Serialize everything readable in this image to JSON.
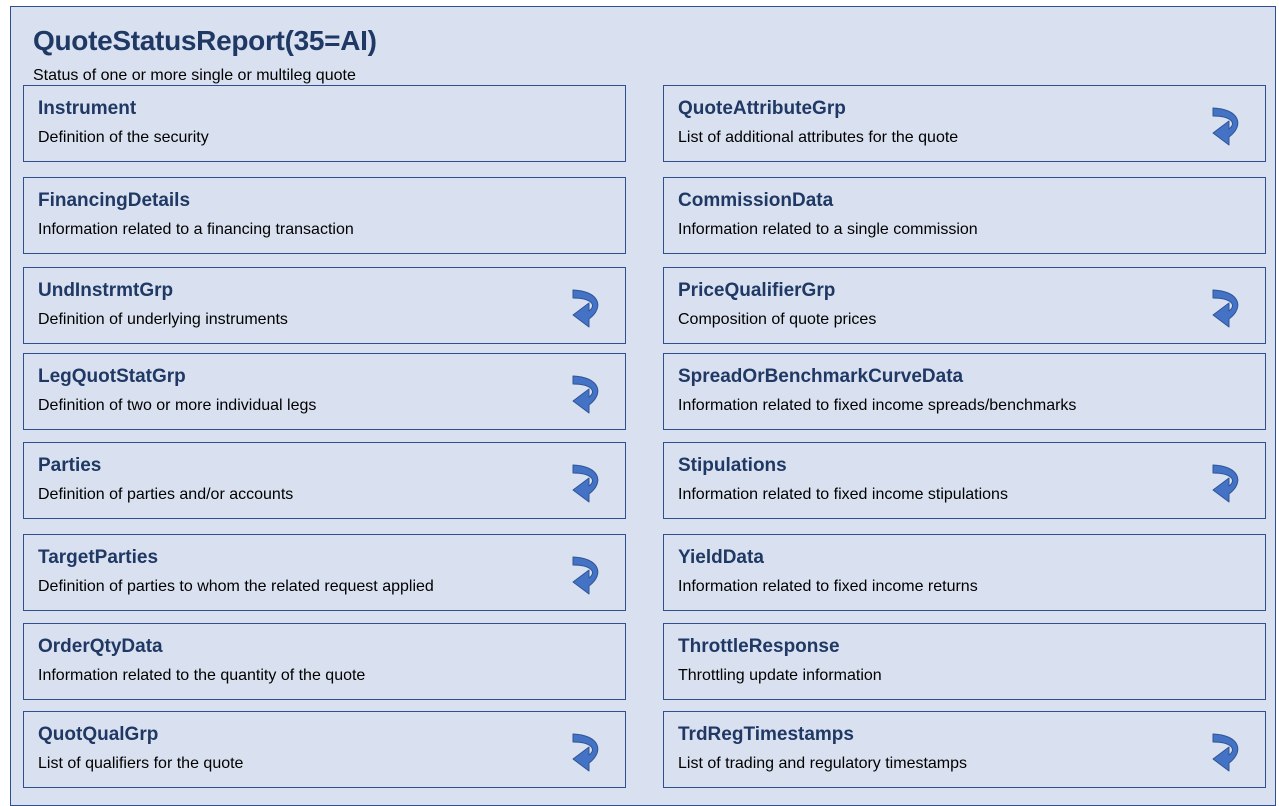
{
  "title": "QuoteStatusReport(35=AI)",
  "subtitle": "Status of one or more single or multileg quote",
  "icon": "repeating-group-curved-arrow-icon",
  "colors": {
    "accent": "#1f3864",
    "background": "#d9e1f0",
    "border": "#2f4f8f",
    "arrow": "#4472c4"
  },
  "left_column": [
    {
      "name": "Instrument",
      "desc": "Definition of the security",
      "repeating": false
    },
    {
      "name": "FinancingDetails",
      "desc": "Information related to a financing transaction",
      "repeating": false
    },
    {
      "name": "UndInstrmtGrp",
      "desc": "Definition of underlying instruments",
      "repeating": true
    },
    {
      "name": "LegQuotStatGrp",
      "desc": "Definition of two or more individual legs",
      "repeating": true
    },
    {
      "name": "Parties",
      "desc": "Definition of parties and/or accounts",
      "repeating": true
    },
    {
      "name": "TargetParties",
      "desc": "Definition of parties to whom the related request applied",
      "repeating": true
    },
    {
      "name": "OrderQtyData",
      "desc": "Information related to the quantity of the quote",
      "repeating": false
    },
    {
      "name": "QuotQualGrp",
      "desc": "List of qualifiers for the quote",
      "repeating": true
    }
  ],
  "right_column": [
    {
      "name": "QuoteAttributeGrp",
      "desc": "List of additional attributes for the quote",
      "repeating": true
    },
    {
      "name": "CommissionData",
      "desc": "Information related to a single commission",
      "repeating": false
    },
    {
      "name": "PriceQualifierGrp",
      "desc": "Composition of quote prices",
      "repeating": true
    },
    {
      "name": "SpreadOrBenchmarkCurveData",
      "desc": "Information related to fixed income spreads/benchmarks",
      "repeating": false
    },
    {
      "name": "Stipulations",
      "desc": "Information related to fixed income stipulations",
      "repeating": true
    },
    {
      "name": "YieldData",
      "desc": "Information related to fixed income returns",
      "repeating": false
    },
    {
      "name": "ThrottleResponse",
      "desc": "Throttling update information",
      "repeating": false
    },
    {
      "name": "TrdRegTimestamps",
      "desc": "List of trading and regulatory timestamps",
      "repeating": true
    }
  ]
}
